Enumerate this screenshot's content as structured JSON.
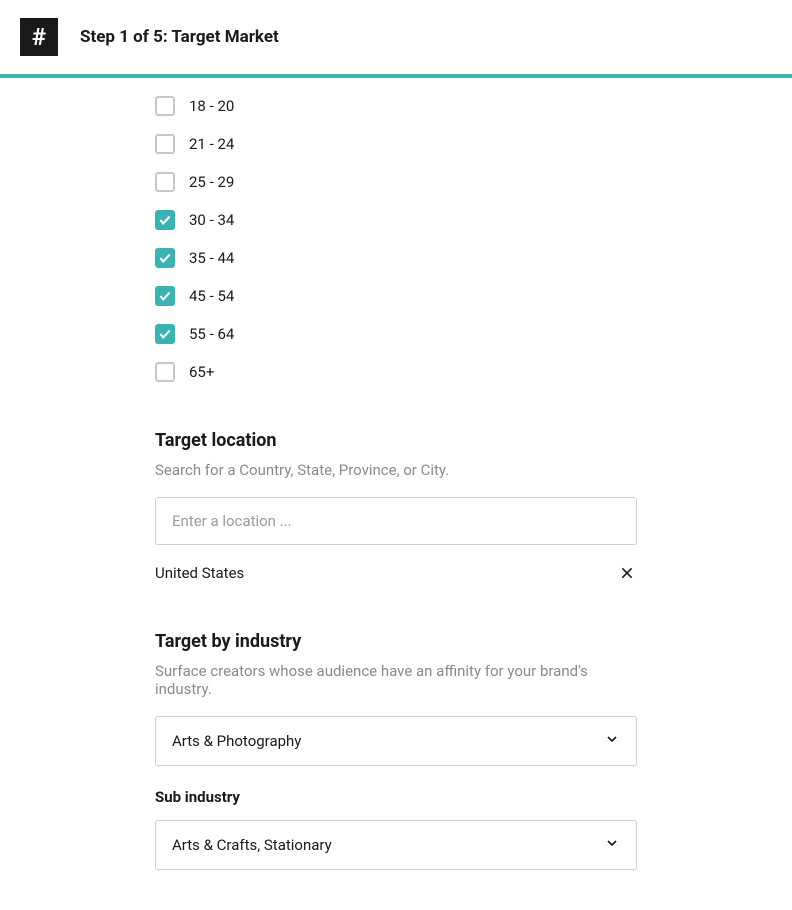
{
  "header": {
    "logo_glyph": "#",
    "step_title": "Step 1 of 5: Target Market"
  },
  "age_ranges": {
    "items": [
      {
        "label": "18 - 20",
        "checked": false
      },
      {
        "label": "21 - 24",
        "checked": false
      },
      {
        "label": "25 - 29",
        "checked": false
      },
      {
        "label": "30 - 34",
        "checked": true
      },
      {
        "label": "35 - 44",
        "checked": true
      },
      {
        "label": "45 - 54",
        "checked": true
      },
      {
        "label": "55 - 64",
        "checked": true
      },
      {
        "label": "65+",
        "checked": false
      }
    ]
  },
  "location": {
    "title": "Target location",
    "subtitle": "Search for a Country, State, Province, or City.",
    "placeholder": "Enter a location ...",
    "selected": "United States"
  },
  "industry": {
    "title": "Target by industry",
    "subtitle": "Surface creators whose audience have an affinity for your brand's industry.",
    "selected": "Arts & Photography",
    "sub_label": "Sub industry",
    "sub_selected": "Arts & Crafts, Stationary"
  },
  "colors": {
    "accent": "#3bb3b3"
  }
}
